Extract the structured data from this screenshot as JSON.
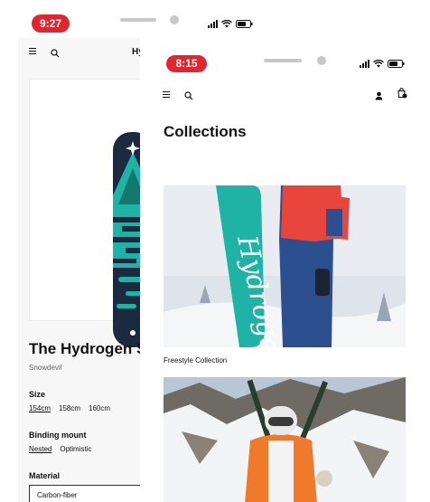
{
  "back_screen": {
    "status_time": "9:27",
    "logo_text": "Hyd",
    "product": {
      "title": "The Hydrogen S",
      "vendor": "Snowdevil"
    },
    "options": {
      "size": {
        "label": "Size",
        "values": [
          "154cm",
          "158cm",
          "160cm"
        ],
        "selected": "154cm"
      },
      "binding": {
        "label": "Binding mount",
        "values": [
          "Nested",
          "Optimistic"
        ],
        "selected": "Nested"
      },
      "material": {
        "label": "Material",
        "value": "Carbon-fiber"
      }
    }
  },
  "front_screen": {
    "status_time": "8:15",
    "title": "Collections",
    "collections": [
      {
        "name": "Freestyle Collection",
        "image_text": "Hydrogen"
      },
      {
        "name": ""
      }
    ]
  },
  "colors": {
    "time_pill": "#e0262e",
    "board_teal": "#1fb3a5",
    "board_navy": "#1c2a3f",
    "jacket_red": "#e8453c",
    "jacket_orange": "#ef7a2c"
  },
  "icons": [
    "menu-icon",
    "search-icon",
    "account-icon",
    "cart-icon",
    "signal-icon",
    "wifi-icon",
    "battery-icon"
  ]
}
